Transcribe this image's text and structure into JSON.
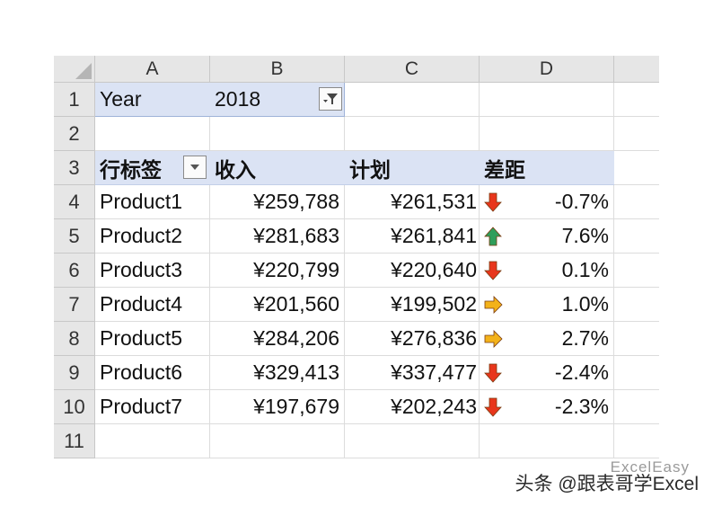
{
  "columns": [
    "A",
    "B",
    "C",
    "D"
  ],
  "rows": [
    "1",
    "2",
    "3",
    "4",
    "5",
    "6",
    "7",
    "8",
    "9",
    "10",
    "11"
  ],
  "filter": {
    "label": "Year",
    "value": "2018"
  },
  "pivot_header": {
    "row_labels": "行标签",
    "revenue": "收入",
    "plan": "计划",
    "gap": "差距"
  },
  "products": [
    {
      "name": "Product1",
      "revenue": "¥259,788",
      "plan": "¥261,531",
      "arrow": "down",
      "gap": "-0.7%"
    },
    {
      "name": "Product2",
      "revenue": "¥281,683",
      "plan": "¥261,841",
      "arrow": "up",
      "gap": "7.6%"
    },
    {
      "name": "Product3",
      "revenue": "¥220,799",
      "plan": "¥220,640",
      "arrow": "down",
      "gap": "0.1%"
    },
    {
      "name": "Product4",
      "revenue": "¥201,560",
      "plan": "¥199,502",
      "arrow": "right",
      "gap": "1.0%"
    },
    {
      "name": "Product5",
      "revenue": "¥284,206",
      "plan": "¥276,836",
      "arrow": "right",
      "gap": "2.7%"
    },
    {
      "name": "Product6",
      "revenue": "¥329,413",
      "plan": "¥337,477",
      "arrow": "down",
      "gap": "-2.4%"
    },
    {
      "name": "Product7",
      "revenue": "¥197,679",
      "plan": "¥202,243",
      "arrow": "down",
      "gap": "-2.3%"
    }
  ],
  "icons": {
    "filter_button": "filter-funnel-icon",
    "dropdown_button": "dropdown-arrow-icon",
    "down": "arrow-down-red-icon",
    "up": "arrow-up-green-icon",
    "right": "arrow-right-yellow-icon"
  },
  "colors": {
    "down": "#e8361c",
    "up": "#2e9e5b",
    "right": "#f3b21a",
    "pivot_header_bg": "#dbe3f4"
  },
  "watermark": {
    "text": "头条 @跟表哥学Excel",
    "ghost": "ExcelEasy"
  }
}
